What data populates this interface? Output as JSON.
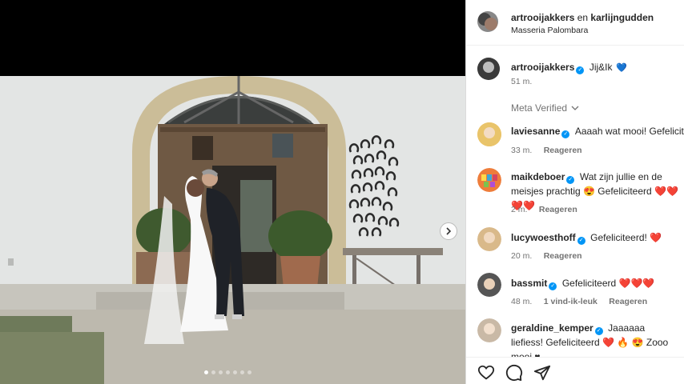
{
  "header": {
    "author1": "artrooijakkers",
    "connector": " en ",
    "author2": "karlijngudden",
    "location": "Masseria Palombara"
  },
  "caption": {
    "user": "artrooijakkers",
    "text": "Jij&Ik",
    "emoji": "💙",
    "time": "51 m.",
    "meta_verified": "Meta Verified"
  },
  "comments": [
    {
      "user": "laviesanne",
      "text": "Aaaah wat mooi! Gefeliciteerd",
      "time": "33 m.",
      "reply": "Reageren",
      "likes": ""
    },
    {
      "user": "maikdeboer",
      "text": "Wat zijn jullie en de meisjes prachtig 😍 Gefeliciteerd ❤️❤️❤️❤️",
      "time": "2 m.",
      "reply": "Reageren",
      "likes": ""
    },
    {
      "user": "lucywoesthoff",
      "text": "Gefeliciteerd! ❤️",
      "time": "20 m.",
      "reply": "Reageren",
      "likes": ""
    },
    {
      "user": "bassmit",
      "text": "Gefeliciteerd ❤️❤️❤️",
      "time": "48 m.",
      "reply": "Reageren",
      "likes": "1 vind-ik-leuk"
    },
    {
      "user": "geraldine_kemper",
      "text": "Jaaaaaa liefiess! Gefeliciteerd ❤️ 🔥 😍 Zooo mooi ♥",
      "time": "",
      "reply": "",
      "likes": ""
    }
  ],
  "carousel": {
    "total": 7,
    "active": 0
  },
  "icons": {
    "like": "heart-icon",
    "comment": "comment-icon",
    "share": "share-icon",
    "next": "chevron-right-icon",
    "chevron": "chevron-down-icon"
  },
  "colors": {
    "verified": "#0095f6",
    "heart": "#ed4956",
    "muted": "#737373"
  }
}
